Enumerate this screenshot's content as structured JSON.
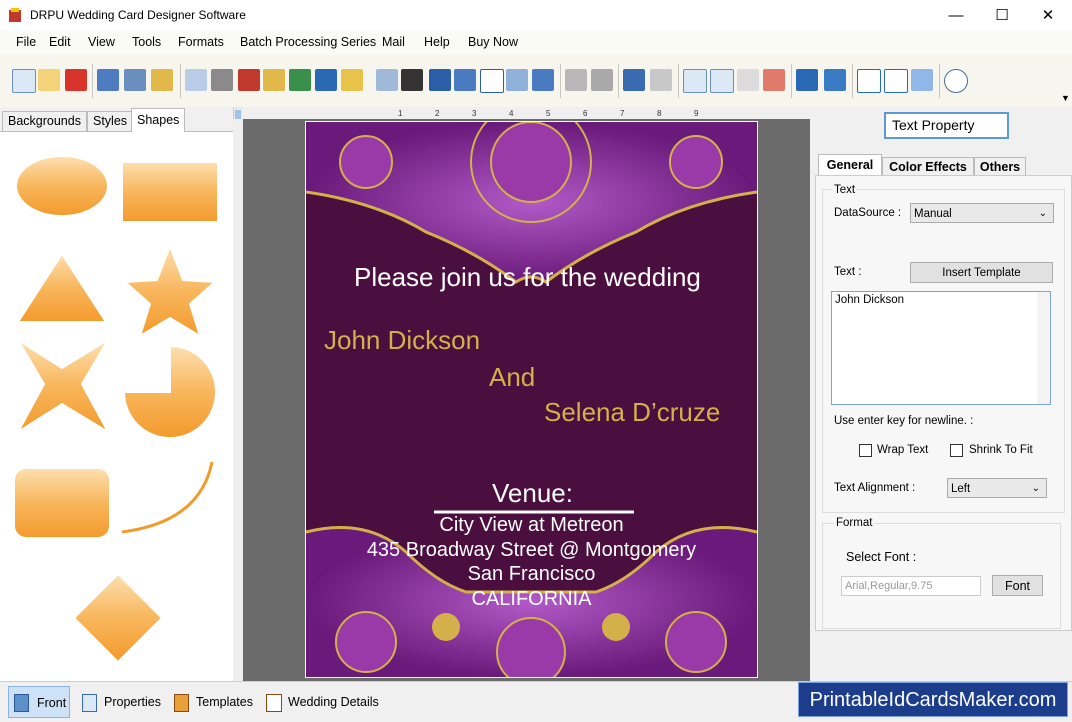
{
  "app": {
    "title": "DRPU Wedding Card Designer Software",
    "minimize": "—",
    "maximize": "☐",
    "close": "✕"
  },
  "menu": [
    "File",
    "Edit",
    "View",
    "Tools",
    "Formats",
    "Batch Processing Series",
    "Mail",
    "Help",
    "Buy Now"
  ],
  "left_tabs": [
    "Backgrounds",
    "Styles",
    "Shapes"
  ],
  "card": {
    "line1": "Please join us for the wedding",
    "name1": "John Dickson",
    "and": "And",
    "name2": "Selena D’cruze",
    "venue_label": "Venue:",
    "addr1": "City View at Metreon",
    "addr2": "435 Broadway Street @ Montgomery",
    "addr3": "San Francisco",
    "addr4": "CALIFORNIA"
  },
  "ruler_numbers": [
    "1",
    "2",
    "3",
    "4",
    "5",
    "6",
    "7",
    "8",
    "9"
  ],
  "right": {
    "header": "Text Property",
    "tabs": [
      "General",
      "Color Effects",
      "Others"
    ],
    "group_text": "Text",
    "datasource_label": "DataSource :",
    "datasource_value": "Manual",
    "text_label": "Text :",
    "insert_template": "Insert Template",
    "text_value": "John Dickson",
    "hint": "Use enter key for newline. :",
    "wrap_text": "Wrap Text",
    "shrink_to_fit": "Shrink To Fit",
    "alignment_label": "Text Alignment :",
    "alignment_value": "Left",
    "group_format": "Format",
    "select_font_label": "Select Font :",
    "font_value": "Arial,Regular,9.75",
    "font_button": "Font"
  },
  "bottom_tabs": [
    "Front",
    "Properties",
    "Templates",
    "Wedding Details"
  ],
  "brand": "PrintableIdCardsMaker.com",
  "colors": {
    "card_bg": "#4a0e3f",
    "gold": "#d4b04a",
    "purple": "#8a3aa0",
    "shape_orange": "#f6a84a"
  }
}
